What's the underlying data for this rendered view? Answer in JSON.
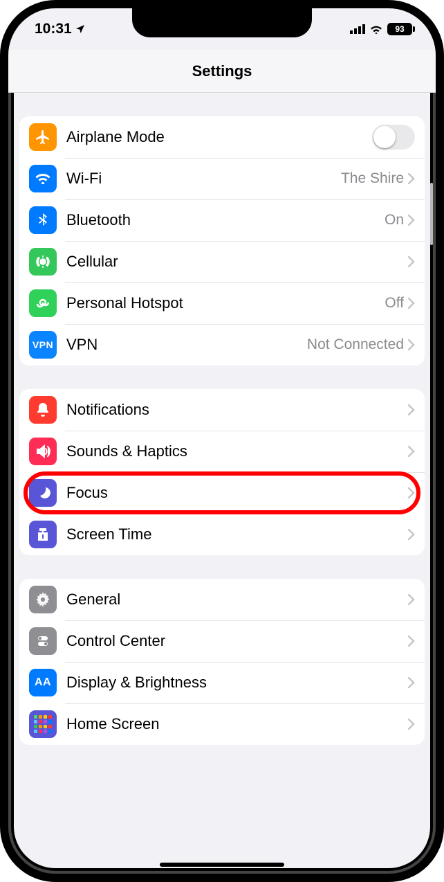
{
  "statusBar": {
    "time": "10:31",
    "battery": "93"
  },
  "header": {
    "title": "Settings"
  },
  "groups": [
    {
      "rows": [
        {
          "id": "airplane",
          "label": "Airplane Mode",
          "detail": "",
          "kind": "toggle"
        },
        {
          "id": "wifi",
          "label": "Wi-Fi",
          "detail": "The Shire",
          "kind": "link"
        },
        {
          "id": "bluetooth",
          "label": "Bluetooth",
          "detail": "On",
          "kind": "link"
        },
        {
          "id": "cellular",
          "label": "Cellular",
          "detail": "",
          "kind": "link"
        },
        {
          "id": "hotspot",
          "label": "Personal Hotspot",
          "detail": "Off",
          "kind": "link"
        },
        {
          "id": "vpn",
          "label": "VPN",
          "detail": "Not Connected",
          "kind": "link"
        }
      ]
    },
    {
      "rows": [
        {
          "id": "notifications",
          "label": "Notifications",
          "detail": "",
          "kind": "link"
        },
        {
          "id": "sounds",
          "label": "Sounds & Haptics",
          "detail": "",
          "kind": "link"
        },
        {
          "id": "focus",
          "label": "Focus",
          "detail": "",
          "kind": "link",
          "highlighted": true
        },
        {
          "id": "screentime",
          "label": "Screen Time",
          "detail": "",
          "kind": "link"
        }
      ]
    },
    {
      "rows": [
        {
          "id": "general",
          "label": "General",
          "detail": "",
          "kind": "link"
        },
        {
          "id": "control",
          "label": "Control Center",
          "detail": "",
          "kind": "link"
        },
        {
          "id": "display",
          "label": "Display & Brightness",
          "detail": "",
          "kind": "link"
        },
        {
          "id": "homescreen",
          "label": "Home Screen",
          "detail": "",
          "kind": "link"
        }
      ]
    }
  ],
  "iconStyles": {
    "airplane": "bg-orange",
    "wifi": "bg-blue",
    "bluetooth": "bg-blue",
    "cellular": "bg-green",
    "hotspot": "bg-greenD",
    "vpn": "bg-blueD",
    "notifications": "bg-red",
    "sounds": "bg-pink",
    "focus": "bg-indigo",
    "screentime": "bg-indigo",
    "general": "bg-gray",
    "control": "bg-gray",
    "display": "bg-blue",
    "homescreen": "bg-indigo"
  },
  "homeScreenColors": [
    "#4cd964",
    "#ff9500",
    "#ffcc00",
    "#ff3b30",
    "#5ac8fa",
    "#ff2d55",
    "#af52de",
    "#007aff",
    "#34c759",
    "#ff9500",
    "#ffcc00",
    "#ff3b30",
    "#5ac8fa",
    "#ff2d55",
    "#af52de",
    "#007aff"
  ]
}
